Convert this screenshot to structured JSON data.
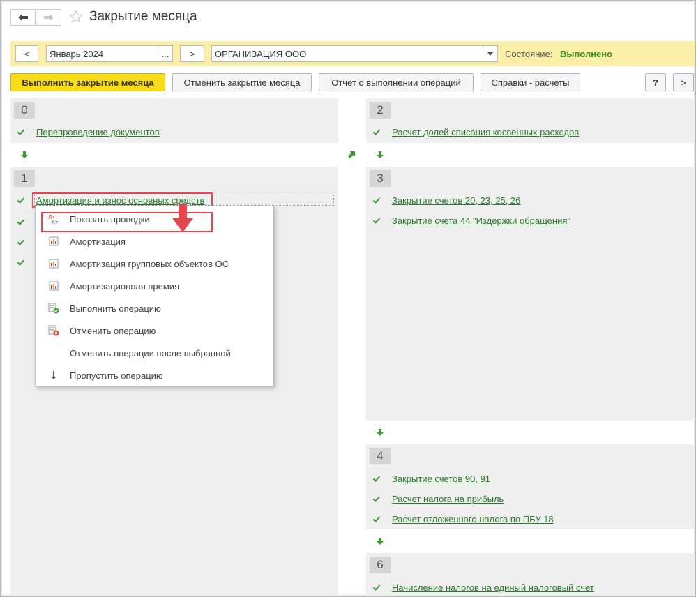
{
  "header": {
    "title": "Закрытие месяца"
  },
  "toolbar": {
    "prev_label": "<",
    "period_value": "Январь 2024",
    "period_choose_label": "...",
    "next_label": ">",
    "organization_value": "ОРГАНИЗАЦИЯ ООО",
    "state_label": "Состояние:",
    "state_value": "Выполнено"
  },
  "commands": {
    "execute": "Выполнить закрытие месяца",
    "cancel": "Отменить закрытие месяца",
    "report": "Отчет о выполнении операций",
    "calc": "Справки - расчеты",
    "help": "?",
    "more": ">"
  },
  "steps": [
    {
      "num": "0",
      "ops": [
        "Перепроведение документов"
      ]
    },
    {
      "num": "1",
      "ops": [
        "Амортизация и износ основных средств"
      ]
    },
    {
      "num": "2",
      "ops": [
        "Расчет долей списания косвенных расходов"
      ]
    },
    {
      "num": "3",
      "ops": [
        "Закрытие счетов 20, 23, 25, 26",
        "Закрытие счета 44 \"Издержки обращения\""
      ]
    },
    {
      "num": "4",
      "ops": [
        "Закрытие счетов 90, 91",
        "Расчет налога на прибыль",
        "Расчет отложенного налога по ПБУ 18"
      ]
    },
    {
      "num": "6",
      "ops": [
        "Начисление налогов на единый налоговый счет"
      ]
    }
  ],
  "context_menu": {
    "items": [
      {
        "label": "Показать проводки",
        "icon": "dt-kt-icon"
      },
      {
        "label": "Амортизация",
        "icon": "report-icon"
      },
      {
        "label": "Амортизация групповых объектов ОС",
        "icon": "report-icon"
      },
      {
        "label": "Амортизационная премия",
        "icon": "report-icon"
      },
      {
        "label": "Выполнить операцию",
        "icon": "execute-operation-icon"
      },
      {
        "label": "Отменить операцию",
        "icon": "cancel-operation-icon"
      },
      {
        "label": "Отменить операции после выбранной",
        "icon": ""
      },
      {
        "label": "Пропустить операцию",
        "icon": "skip-arrow-icon"
      }
    ]
  },
  "colors": {
    "accent_yellow": "#f9dc17",
    "toolbar_yellow": "#fbeea6",
    "link_green": "#2a7c28",
    "highlight_red": "#e8464f"
  }
}
